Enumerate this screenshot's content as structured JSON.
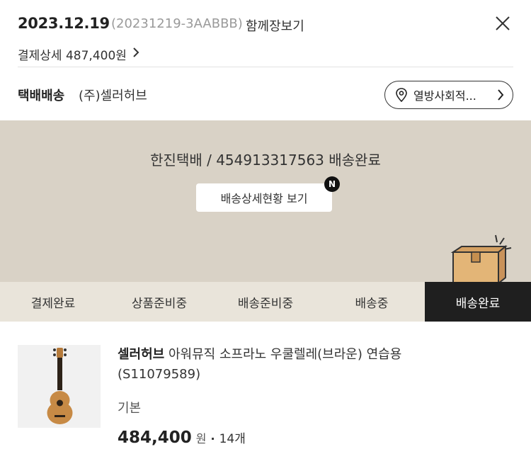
{
  "header": {
    "date": "2023.12.19",
    "order_id": "(20231219-3AABBB)",
    "together_label": "함께장보기",
    "close_icon": "close-icon"
  },
  "payment": {
    "label": "결제상세 487,400원"
  },
  "shipping": {
    "type": "택배배송",
    "seller": "(주)셀러허브",
    "address_label": "열방사회적...",
    "pin_icon": "location-pin-icon"
  },
  "tracking": {
    "line": "한진택배 / 454913317563 배송완료",
    "detail_button": "배송상세현황 보기",
    "new_badge": "N",
    "bg_color": "#d9d2c6",
    "box_icon": "delivery-box-icon"
  },
  "steps": [
    {
      "label": "결제완료",
      "active": false
    },
    {
      "label": "상품준비중",
      "active": false
    },
    {
      "label": "배송준비중",
      "active": false
    },
    {
      "label": "배송중",
      "active": false
    },
    {
      "label": "배송완료",
      "active": true
    }
  ],
  "product": {
    "brand": "셀러허브",
    "name": "아워뮤직 소프라노 우쿨렐레(브라운) 연습용",
    "code": "(S11079589)",
    "option": "기본",
    "price": "484,400",
    "currency": "원",
    "separator": "·",
    "quantity": "14개",
    "thumbnail_icon": "ukulele-image"
  }
}
